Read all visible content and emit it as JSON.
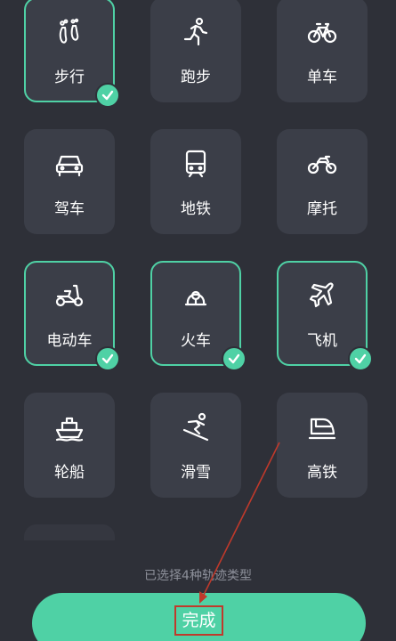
{
  "modes": [
    {
      "label": "步行",
      "icon": "footprints-icon",
      "selected": true
    },
    {
      "label": "跑步",
      "icon": "running-person-icon",
      "selected": false
    },
    {
      "label": "单车",
      "icon": "bicycle-icon",
      "selected": false
    },
    {
      "label": "驾车",
      "icon": "car-icon",
      "selected": false
    },
    {
      "label": "地铁",
      "icon": "subway-icon",
      "selected": false
    },
    {
      "label": "摩托",
      "icon": "motorcycle-icon",
      "selected": false
    },
    {
      "label": "电动车",
      "icon": "scooter-icon",
      "selected": true
    },
    {
      "label": "火车",
      "icon": "train-icon",
      "selected": true
    },
    {
      "label": "飞机",
      "icon": "airplane-icon",
      "selected": true
    },
    {
      "label": "轮船",
      "icon": "ship-icon",
      "selected": false
    },
    {
      "label": "滑雪",
      "icon": "skiing-icon",
      "selected": false
    },
    {
      "label": "高铁",
      "icon": "high-speed-rail-icon",
      "selected": false
    }
  ],
  "footer": {
    "hint": "已选择4种轨迹类型",
    "done_label": "完成"
  },
  "colors": {
    "background": "#2e3038",
    "tile": "#3b3e48",
    "accent": "#4fd1a5",
    "annotation": "#c0392b"
  }
}
